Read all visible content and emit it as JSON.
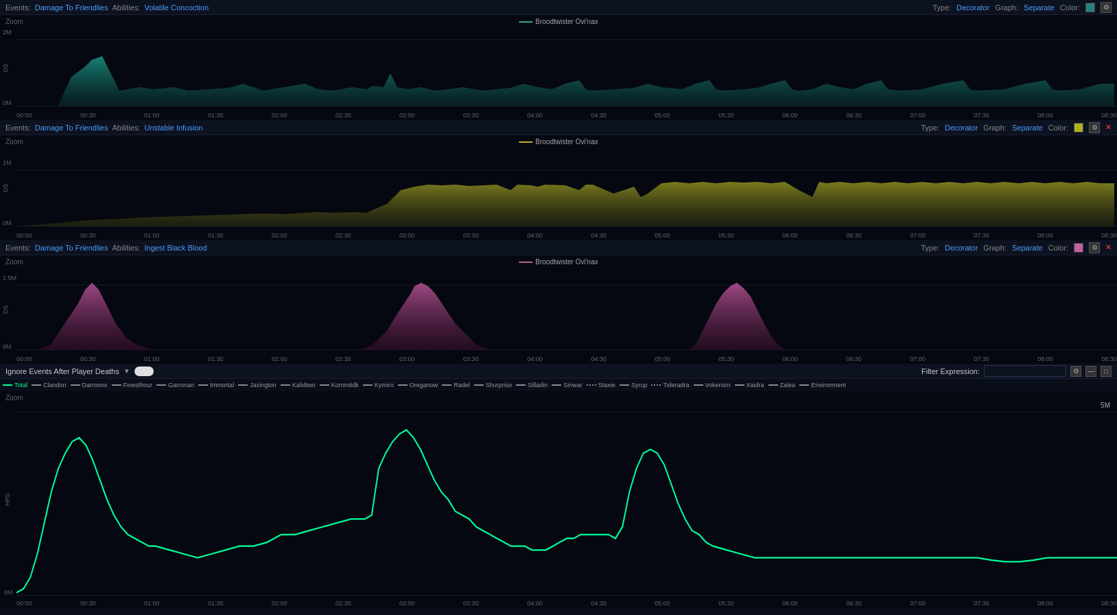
{
  "panels": [
    {
      "id": "panel1",
      "events_label": "Events:",
      "events_value": "Damage To Friendlies",
      "abilities_label": "Abilities:",
      "abilities_value": "Volatile Concoction",
      "type_label": "Type:",
      "type_value": "Decorator",
      "graph_label": "Graph:",
      "graph_value": "Separate",
      "color_label": "Color:",
      "color": "#2a8080",
      "legend_name": "Broodtwister Ovi'nax",
      "legend_color": "#2aaa99",
      "y_max": "2M",
      "y_min": "0M",
      "chart_color": "#1a9080",
      "zoom_label": "Zoom"
    },
    {
      "id": "panel2",
      "events_label": "Events:",
      "events_value": "Damage To Friendlies",
      "abilities_label": "Abilities:",
      "abilities_value": "Unstable Infusion",
      "type_label": "Type:",
      "type_value": "Decorator",
      "graph_label": "Graph:",
      "graph_value": "Separate",
      "color_label": "Color:",
      "color": "#b0b020",
      "legend_name": "Broodtwister Ovi'nax",
      "legend_color": "#c0b030",
      "y_max": "1M",
      "y_min": "0M",
      "chart_color": "#909020",
      "zoom_label": "Zoom",
      "has_close": true
    },
    {
      "id": "panel3",
      "events_label": "Events:",
      "events_value": "Damage To Friendlies",
      "abilities_label": "Abilities:",
      "abilities_value": "Ingest Black Blood",
      "type_label": "Type:",
      "type_value": "Decorator",
      "graph_label": "Graph:",
      "graph_value": "Separate",
      "color_label": "Color:",
      "color": "#c060a0",
      "legend_name": "Broodtwister Ovi'nax",
      "legend_color": "#c060a0",
      "y_max": "2.5M",
      "y_min": "0M",
      "chart_color": "#b05090",
      "zoom_label": "Zoom",
      "has_close": true
    }
  ],
  "bottom_panel": {
    "ignore_label": "Ignore Events After Player Deaths",
    "toggle_enabled": true,
    "filter_label": "Filter Expression:",
    "filter_placeholder": "",
    "zoom_label": "Zoom",
    "y_label": "HPS",
    "y_max": "5M",
    "y_min": "0M",
    "legend_items": [
      {
        "name": "Total",
        "color": "#00ff99",
        "style": "solid"
      },
      {
        "name": "Clandon",
        "color": "#888",
        "style": "dashed"
      },
      {
        "name": "Darroonx",
        "color": "#888",
        "style": "dashed"
      },
      {
        "name": "Finesthour",
        "color": "#888",
        "style": "dotdash"
      },
      {
        "name": "Garronan",
        "color": "#888",
        "style": "dashed"
      },
      {
        "name": "Immortal",
        "color": "#888",
        "style": "dashed"
      },
      {
        "name": "Jaxington",
        "color": "#888",
        "style": "dashed"
      },
      {
        "name": "Kalidtwo",
        "color": "#888",
        "style": "dashed"
      },
      {
        "name": "Kommitdk",
        "color": "#888",
        "style": "dashed"
      },
      {
        "name": "Kymiro",
        "color": "#888",
        "style": "dashed"
      },
      {
        "name": "Oreganow",
        "color": "#888",
        "style": "dashed"
      },
      {
        "name": "Radel",
        "color": "#888",
        "style": "dashed"
      },
      {
        "name": "Shurprise",
        "color": "#888",
        "style": "dashed"
      },
      {
        "name": "Silladin",
        "color": "#888",
        "style": "dashed"
      },
      {
        "name": "Sinwar",
        "color": "#888",
        "style": "dashed"
      },
      {
        "name": "Staxie",
        "color": "#888",
        "style": "dotted"
      },
      {
        "name": "Syrup",
        "color": "#888",
        "style": "dashed"
      },
      {
        "name": "Tideradra",
        "color": "#888",
        "style": "dotted"
      },
      {
        "name": "Vokerism",
        "color": "#888",
        "style": "dashed"
      },
      {
        "name": "Xaidra",
        "color": "#888",
        "style": "dashed"
      },
      {
        "name": "Zalea",
        "color": "#888",
        "style": "dashed"
      },
      {
        "name": "Environment",
        "color": "#888",
        "style": "dashed"
      }
    ]
  },
  "x_ticks": [
    "00:00",
    "00:30",
    "01:00",
    "01:30",
    "02:00",
    "02:30",
    "03:00",
    "03:30",
    "04:00",
    "04:30",
    "05:00",
    "05:30",
    "06:00",
    "06:30",
    "07:00",
    "07:30",
    "08:00",
    "08:30"
  ]
}
